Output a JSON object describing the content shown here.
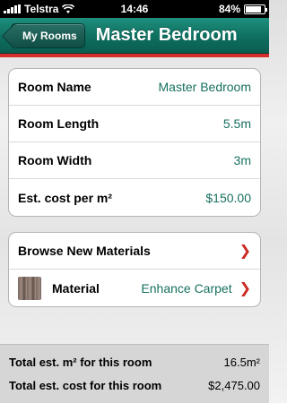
{
  "status": {
    "carrier": "Telstra",
    "time": "14:46",
    "battery": "84%",
    "battery_level": 0.84
  },
  "nav": {
    "back_label": "My Rooms",
    "title": "Master Bedroom"
  },
  "details": [
    {
      "label": "Room Name",
      "value": "Master Bedroom"
    },
    {
      "label": "Room Length",
      "value": "5.5m"
    },
    {
      "label": "Room Width",
      "value": "3m"
    },
    {
      "label": "Est. cost per m²",
      "value": "$150.00"
    }
  ],
  "materials": {
    "browse_label": "Browse New Materials",
    "material_label": "Material",
    "material_value": "Enhance Carpet"
  },
  "totals": [
    {
      "label": "Total est. m² for this room",
      "value": "16.5m²"
    },
    {
      "label": "Total est. cost for this room",
      "value": "$2,475.00"
    }
  ],
  "colors": {
    "nav_green": "#0e6e5f",
    "accent_red": "#d62e2a",
    "value_green": "#17705f"
  }
}
